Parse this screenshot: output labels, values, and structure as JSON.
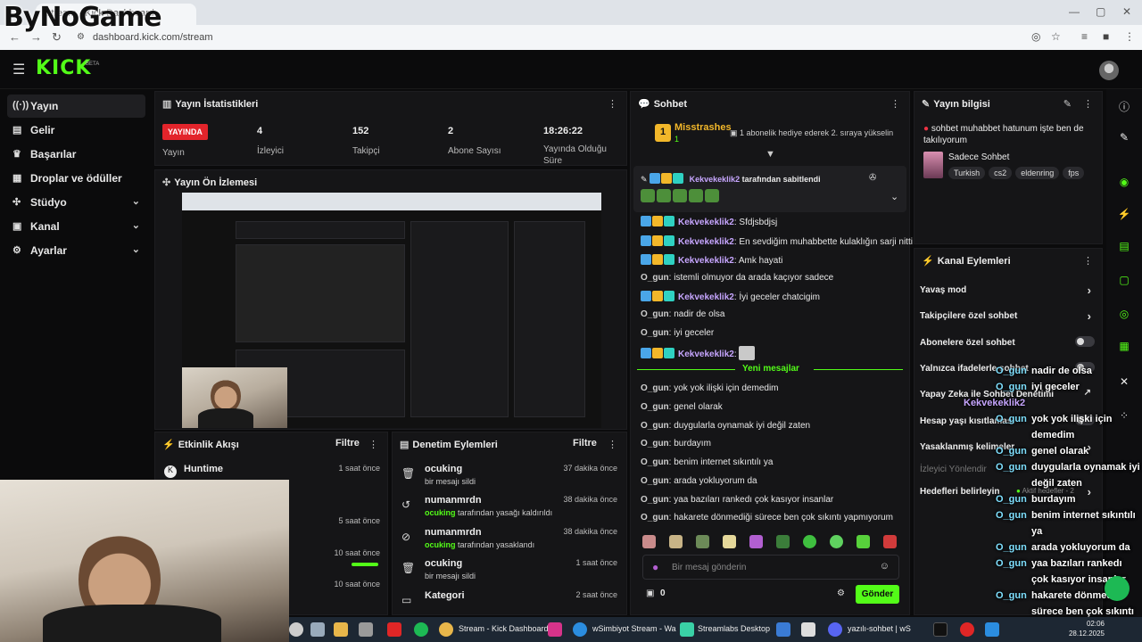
{
  "watermark": "ByNoGame",
  "browser": {
    "tab_title": "Stream - Kick Dashboard",
    "url": "dashboard.kick.com/stream"
  },
  "header": {
    "logo": "KICK",
    "beta": "BETA"
  },
  "sidebar": {
    "items": [
      {
        "label": "Yayın",
        "icon": "stream-icon"
      },
      {
        "label": "Gelir",
        "icon": "revenue-icon"
      },
      {
        "label": "Başarılar",
        "icon": "trophy-icon"
      },
      {
        "label": "Droplar ve ödüller",
        "icon": "gift-icon"
      },
      {
        "label": "Stüdyo",
        "icon": "studio-icon"
      },
      {
        "label": "Kanal",
        "icon": "channel-icon"
      },
      {
        "label": "Ayarlar",
        "icon": "gear-icon"
      }
    ]
  },
  "stats": {
    "title": "Yayın İstatistikleri",
    "live": "YAYINDA",
    "live_label": "Yayın",
    "viewers": "4",
    "viewers_label": "İzleyici",
    "followers": "152",
    "followers_label": "Takipçi",
    "subs": "2",
    "subs_label": "Abone Sayısı",
    "duration": "18:26:22",
    "duration_label": "Yayında Olduğu Süre"
  },
  "preview": {
    "title": "Yayın Ön İzlemesi"
  },
  "activity": {
    "title": "Etkinlik Akışı",
    "filter": "Filtre",
    "rows": [
      {
        "name": "Huntime",
        "time": "1 saat önce"
      },
      {
        "name": "",
        "time": "5 saat önce"
      },
      {
        "name": "",
        "time": "10 saat önce"
      },
      {
        "name": "",
        "time": "10 saat önce"
      }
    ]
  },
  "moderation": {
    "title": "Denetim Eylemleri",
    "filter": "Filtre",
    "rows": [
      {
        "name": "ocuking",
        "actor": "",
        "sub": "bir mesajı sildi",
        "time": "37 dakika önce",
        "icon": "trash-icon"
      },
      {
        "name": "numanmrdn",
        "actor": "ocuking",
        "sub": "tarafından yasağı kaldırıldı",
        "time": "38 dakika önce",
        "icon": "unban-icon"
      },
      {
        "name": "numanmrdn",
        "actor": "ocuking",
        "sub": "tarafından yasaklandı",
        "time": "38 dakika önce",
        "icon": "ban-icon"
      },
      {
        "name": "ocuking",
        "actor": "",
        "sub": "bir mesajı sildi",
        "time": "1 saat önce",
        "icon": "trash-icon"
      },
      {
        "name": "Kategori",
        "actor": "",
        "sub": "",
        "time": "2 saat önce",
        "icon": "category-icon"
      }
    ]
  },
  "chat": {
    "title": "Sohbet",
    "top_user": "Misstrashes",
    "top_rank": "1",
    "top_count": "1",
    "top_msg": "1 abonelik hediye ederek 2. sıraya yükselin",
    "pinned_user": "Kekvekeklik2",
    "pinned_suffix": "tarafından sabitlendi",
    "messages": [
      {
        "user": "Kekvekeklik2",
        "kind": "k",
        "text": "Sfdjsbdjsj"
      },
      {
        "user": "Kekvekeklik2",
        "kind": "k",
        "text": "En sevdiğim muhabbette kulaklığın sarji nitti"
      },
      {
        "user": "Kekvekeklik2",
        "kind": "k",
        "text": "Amk hayati"
      },
      {
        "user": "O_gun",
        "kind": "u",
        "text": "istemli olmuyor da arada kaçıyor sadece"
      },
      {
        "user": "Kekvekeklik2",
        "kind": "k",
        "text": "İyi geceler chatcigim"
      },
      {
        "user": "O_gun",
        "kind": "u",
        "text": "nadir de olsa"
      },
      {
        "user": "O_gun",
        "kind": "u",
        "text": "iyi geceler"
      },
      {
        "user": "Kekvekeklik2",
        "kind": "k",
        "text": ""
      },
      {
        "user": "O_gun",
        "kind": "u",
        "text": "yok yok ilişki için demedim"
      },
      {
        "user": "O_gun",
        "kind": "u",
        "text": "genel olarak"
      },
      {
        "user": "O_gun",
        "kind": "u",
        "text": "duygularla oynamak iyi değil zaten"
      },
      {
        "user": "O_gun",
        "kind": "u",
        "text": "burdayım"
      },
      {
        "user": "O_gun",
        "kind": "u",
        "text": "benim internet sıkıntılı ya"
      },
      {
        "user": "O_gun",
        "kind": "u",
        "text": "arada yokluyorum da"
      },
      {
        "user": "O_gun",
        "kind": "u",
        "text": "yaa bazıları rankedı çok kasıyor insanlar"
      },
      {
        "user": "O_gun",
        "kind": "u",
        "text": "hakarete dönmediği sürece ben çok sıkıntı yapmıyorum"
      }
    ],
    "new_messages": "Yeni mesajlar",
    "input_placeholder": "Bir mesaj gönderin",
    "points": "0",
    "send": "Gönder"
  },
  "stream_info": {
    "title": "Yayın bilgisi",
    "stream_title": "sohbet muhabbet hatunum işte ben de takılıyorum",
    "category": "Sadece Sohbet",
    "tags": [
      "Turkish",
      "cs2",
      "eldenring",
      "fps"
    ]
  },
  "channel_actions": {
    "title": "Kanal Eylemleri",
    "rows": [
      {
        "label": "Yavaş mod",
        "type": "arrow"
      },
      {
        "label": "Takipçilere özel sohbet",
        "type": "arrow"
      },
      {
        "label": "Abonelere özel sohbet",
        "type": "toggle"
      },
      {
        "label": "Yalnızca ifadelerle sohbet",
        "type": "toggle"
      },
      {
        "label": "Yapay Zeka ile Sohbet Denetimi",
        "type": "external"
      },
      {
        "label": "Hesap yaşı kısıtlaması",
        "type": "toggle"
      },
      {
        "label": "Yasaklanmış kelimeler",
        "type": "arrow"
      },
      {
        "label": "İzleyici Yönlendir",
        "type": "none"
      },
      {
        "label": "Hedefleri belirleyin",
        "type": "arrow",
        "extra": "Aktif hedefler - 2"
      }
    ]
  },
  "overlay": [
    {
      "user": "O_gun",
      "text": "nadir de olsa"
    },
    {
      "user": "O_gun",
      "text": "iyi geceler"
    },
    {
      "user": "Kekvekeklik2",
      "text": ""
    },
    {
      "user": "O_gun",
      "text": "yok yok ilişki için"
    },
    {
      "user": "",
      "text": "demedim"
    },
    {
      "user": "O_gun",
      "text": "genel olarak"
    },
    {
      "user": "O_gun",
      "text": "duygularla oynamak iyi"
    },
    {
      "user": "",
      "text": "değil zaten"
    },
    {
      "user": "O_gun",
      "text": "burdayım"
    },
    {
      "user": "O_gun",
      "text": "benim internet sıkıntılı"
    },
    {
      "user": "",
      "text": "ya"
    },
    {
      "user": "O_gun",
      "text": "arada yokluyorum da"
    },
    {
      "user": "O_gun",
      "text": "yaa bazıları rankedı"
    },
    {
      "user": "",
      "text": "çok kasıyor insanlar"
    },
    {
      "user": "O_gun",
      "text": "hakarete dönmediği"
    },
    {
      "user": "",
      "text": "sürece ben çok sıkıntı"
    },
    {
      "user": "",
      "text": "yapmıyorum"
    }
  ],
  "taskbar": {
    "apps": [
      "Stream - Kick Dashboard",
      "wSimbiyot Stream - Wa",
      "Streamlabs Desktop",
      "yazılı-sohbet | wS"
    ],
    "time": "02:06",
    "date": "28.12.2025"
  }
}
